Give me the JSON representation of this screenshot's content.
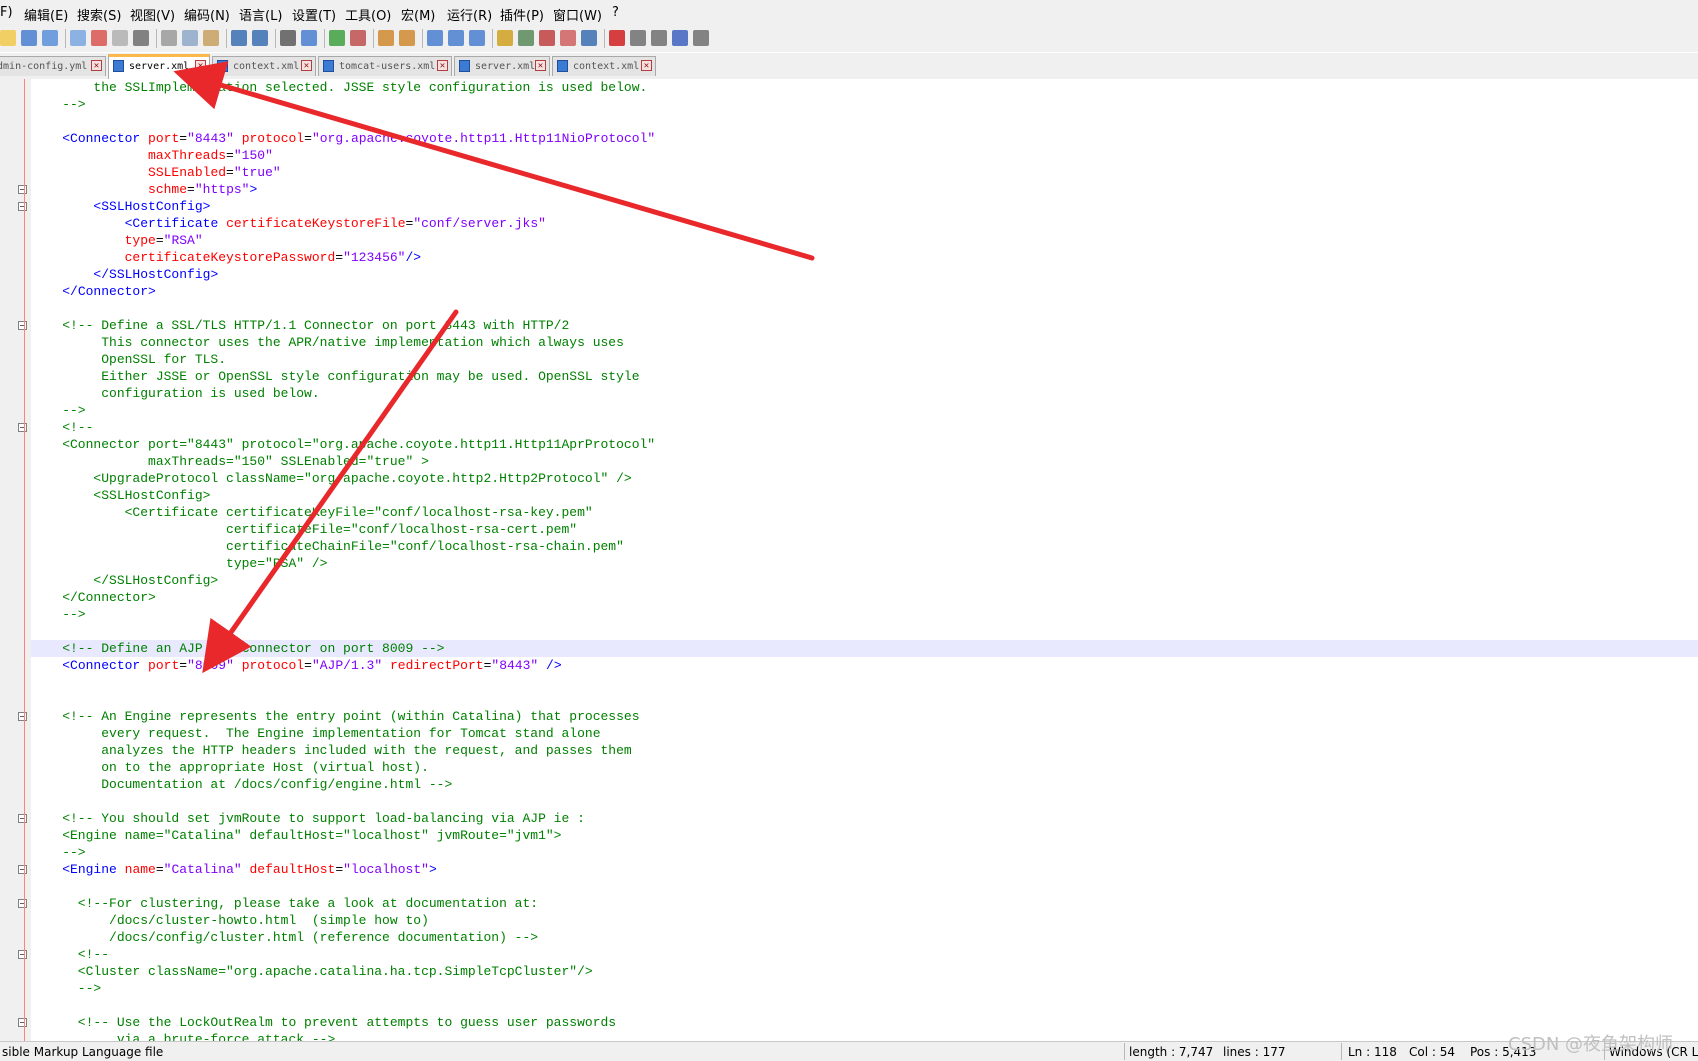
{
  "menubar": {
    "items": [
      "F)",
      "编辑(E)",
      "搜索(S)",
      "视图(V)",
      "编码(N)",
      "语言(L)",
      "设置(T)",
      "工具(O)",
      "宏(M)",
      "运行(R)",
      "插件(P)",
      "窗口(W)",
      "?"
    ]
  },
  "toolbar": {
    "buttons": [
      "new-icon",
      "open-icon",
      "save-icon",
      "save-all-icon",
      "close-icon",
      "close-all-icon",
      "print-icon",
      "cut-icon",
      "copy-icon",
      "paste-icon",
      "undo-icon",
      "redo-icon",
      "find-icon",
      "replace-icon",
      "zoom-in-icon",
      "zoom-out-icon",
      "sync-v-icon",
      "sync-h-icon",
      "wrap-icon",
      "show-all-chars-icon",
      "indent-guide-icon",
      "udl-icon",
      "doc-map-icon",
      "function-list-icon",
      "folder-workspace-icon",
      "monitor-icon",
      "record-macro-icon",
      "stop-record-icon",
      "play-macro-icon",
      "run-multiple-icon",
      "save-macro-icon"
    ]
  },
  "tabs": [
    {
      "label": "admin-config.yml",
      "active": false
    },
    {
      "label": "server.xml",
      "active": true
    },
    {
      "label": "context.xml",
      "active": false
    },
    {
      "label": "tomcat-users.xml",
      "active": false
    },
    {
      "label": "server.xml",
      "active": false
    },
    {
      "label": "context.xml",
      "active": false
    }
  ],
  "editor": {
    "current_line_index": 33,
    "lines": [
      [
        [
          "cm",
          "        the SSLImplementation selected. JSSE style configuration is used below."
        ]
      ],
      [
        [
          "cm",
          "    -->"
        ]
      ],
      [],
      [
        [
          "tx",
          "    "
        ],
        [
          "tg",
          "<Connector"
        ],
        [
          "tx",
          " "
        ],
        [
          "at",
          "port"
        ],
        [
          "tx",
          "="
        ],
        [
          "vl",
          "\"8443\""
        ],
        [
          "tx",
          " "
        ],
        [
          "at",
          "protocol"
        ],
        [
          "tx",
          "="
        ],
        [
          "vl",
          "\"org.apache.coyote.http11.Http11NioProtocol\""
        ]
      ],
      [
        [
          "tx",
          "               "
        ],
        [
          "at",
          "maxThreads"
        ],
        [
          "tx",
          "="
        ],
        [
          "vl",
          "\"150\""
        ]
      ],
      [
        [
          "tx",
          "               "
        ],
        [
          "at",
          "SSLEnabled"
        ],
        [
          "tx",
          "="
        ],
        [
          "vl",
          "\"true\""
        ]
      ],
      [
        [
          "tx",
          "               "
        ],
        [
          "at",
          "schme"
        ],
        [
          "tx",
          "="
        ],
        [
          "vl",
          "\"https\""
        ],
        [
          "tg",
          ">"
        ]
      ],
      [
        [
          "tx",
          "        "
        ],
        [
          "tg",
          "<SSLHostConfig>"
        ]
      ],
      [
        [
          "tx",
          "            "
        ],
        [
          "tg",
          "<Certificate"
        ],
        [
          "tx",
          " "
        ],
        [
          "at",
          "certificateKeystoreFile"
        ],
        [
          "tx",
          "="
        ],
        [
          "vl",
          "\"conf/server.jks\""
        ]
      ],
      [
        [
          "tx",
          "            "
        ],
        [
          "at",
          "type"
        ],
        [
          "tx",
          "="
        ],
        [
          "vl",
          "\"RSA\""
        ]
      ],
      [
        [
          "tx",
          "            "
        ],
        [
          "at",
          "certificateKeystorePassword"
        ],
        [
          "tx",
          "="
        ],
        [
          "vl",
          "\"123456\""
        ],
        [
          "tg",
          "/>"
        ]
      ],
      [
        [
          "tx",
          "        "
        ],
        [
          "tg",
          "</SSLHostConfig>"
        ]
      ],
      [
        [
          "tx",
          "    "
        ],
        [
          "tg",
          "</Connector>"
        ]
      ],
      [],
      [
        [
          "cm",
          "    <!-- Define a SSL/TLS HTTP/1.1 Connector on port 8443 with HTTP/2"
        ]
      ],
      [
        [
          "cm",
          "         This connector uses the APR/native implementation which always uses"
        ]
      ],
      [
        [
          "cm",
          "         OpenSSL for TLS."
        ]
      ],
      [
        [
          "cm",
          "         Either JSSE or OpenSSL style configuration may be used. OpenSSL style"
        ]
      ],
      [
        [
          "cm",
          "         configuration is used below."
        ]
      ],
      [
        [
          "cm",
          "    -->"
        ]
      ],
      [
        [
          "cm",
          "    <!--"
        ]
      ],
      [
        [
          "cm",
          "    <Connector port=\"8443\" protocol=\"org.apache.coyote.http11.Http11AprProtocol\""
        ]
      ],
      [
        [
          "cm",
          "               maxThreads=\"150\" SSLEnabled=\"true\" >"
        ]
      ],
      [
        [
          "cm",
          "        <UpgradeProtocol className=\"org.apache.coyote.http2.Http2Protocol\" />"
        ]
      ],
      [
        [
          "cm",
          "        <SSLHostConfig>"
        ]
      ],
      [
        [
          "cm",
          "            <Certificate certificateKeyFile=\"conf/localhost-rsa-key.pem\""
        ]
      ],
      [
        [
          "cm",
          "                         certificateFile=\"conf/localhost-rsa-cert.pem\""
        ]
      ],
      [
        [
          "cm",
          "                         certificateChainFile=\"conf/localhost-rsa-chain.pem\""
        ]
      ],
      [
        [
          "cm",
          "                         type=\"RSA\" />"
        ]
      ],
      [
        [
          "cm",
          "        </SSLHostConfig>"
        ]
      ],
      [
        [
          "cm",
          "    </Connector>"
        ]
      ],
      [
        [
          "cm",
          "    -->"
        ]
      ],
      [],
      [
        [
          "cm",
          "    <!-- Define an AJP 1.3 Connector on port 8009 -->"
        ]
      ],
      [
        [
          "tx",
          "    "
        ],
        [
          "tg",
          "<Connector"
        ],
        [
          "tx",
          " "
        ],
        [
          "at",
          "port"
        ],
        [
          "tx",
          "="
        ],
        [
          "vl",
          "\"8009\""
        ],
        [
          "tx",
          " "
        ],
        [
          "at",
          "protocol"
        ],
        [
          "tx",
          "="
        ],
        [
          "vl",
          "\"AJP/1.3\""
        ],
        [
          "tx",
          " "
        ],
        [
          "at",
          "redirectPort"
        ],
        [
          "tx",
          "="
        ],
        [
          "vl",
          "\"8443\""
        ],
        [
          "tx",
          " "
        ],
        [
          "tg",
          "/>"
        ]
      ],
      [],
      [],
      [
        [
          "cm",
          "    <!-- An Engine represents the entry point (within Catalina) that processes"
        ]
      ],
      [
        [
          "cm",
          "         every request.  The Engine implementation for Tomcat stand alone"
        ]
      ],
      [
        [
          "cm",
          "         analyzes the HTTP headers included with the request, and passes them"
        ]
      ],
      [
        [
          "cm",
          "         on to the appropriate Host (virtual host)."
        ]
      ],
      [
        [
          "cm",
          "         Documentation at /docs/config/engine.html -->"
        ]
      ],
      [],
      [
        [
          "cm",
          "    <!-- You should set jvmRoute to support load-balancing via AJP ie :"
        ]
      ],
      [
        [
          "cm",
          "    <Engine name=\"Catalina\" defaultHost=\"localhost\" jvmRoute=\"jvm1\">"
        ]
      ],
      [
        [
          "cm",
          "    -->"
        ]
      ],
      [
        [
          "tx",
          "    "
        ],
        [
          "tg",
          "<Engine"
        ],
        [
          "tx",
          " "
        ],
        [
          "at",
          "name"
        ],
        [
          "tx",
          "="
        ],
        [
          "vl",
          "\"Catalina\""
        ],
        [
          "tx",
          " "
        ],
        [
          "at",
          "defaultHost"
        ],
        [
          "tx",
          "="
        ],
        [
          "vl",
          "\"localhost\""
        ],
        [
          "tg",
          ">"
        ]
      ],
      [],
      [
        [
          "cm",
          "      <!--For clustering, please take a look at documentation at:"
        ]
      ],
      [
        [
          "cm",
          "          /docs/cluster-howto.html  (simple how to)"
        ]
      ],
      [
        [
          "cm",
          "          /docs/config/cluster.html (reference documentation) -->"
        ]
      ],
      [
        [
          "cm",
          "      <!--"
        ]
      ],
      [
        [
          "cm",
          "      <Cluster className=\"org.apache.catalina.ha.tcp.SimpleTcpCluster\"/>"
        ]
      ],
      [
        [
          "cm",
          "      -->"
        ]
      ],
      [],
      [
        [
          "cm",
          "      <!-- Use the LockOutRealm to prevent attempts to guess user passwords"
        ]
      ],
      [
        [
          "cm",
          "           via a brute-force attack -->"
        ]
      ]
    ],
    "fold_lines": [
      6,
      7,
      14,
      20,
      37,
      43,
      46,
      48,
      51,
      55
    ]
  },
  "statusbar": {
    "file_type": "sible Markup Language file",
    "length": "length : 7,747",
    "lines": "lines : 177",
    "ln": "Ln : 118",
    "col": "Col : 54",
    "pos": "Pos : 5,413",
    "eol": "Windows (CR LF)"
  },
  "watermark": "CSDN @夜鱼架构师",
  "colors": {
    "comment": "#008000",
    "tag": "#0000ff",
    "attribute": "#ff0000",
    "value": "#8000ff",
    "arrow": "#e8282b",
    "current_line": "#e8e8ff",
    "active_tab_accent": "#fab94a"
  }
}
